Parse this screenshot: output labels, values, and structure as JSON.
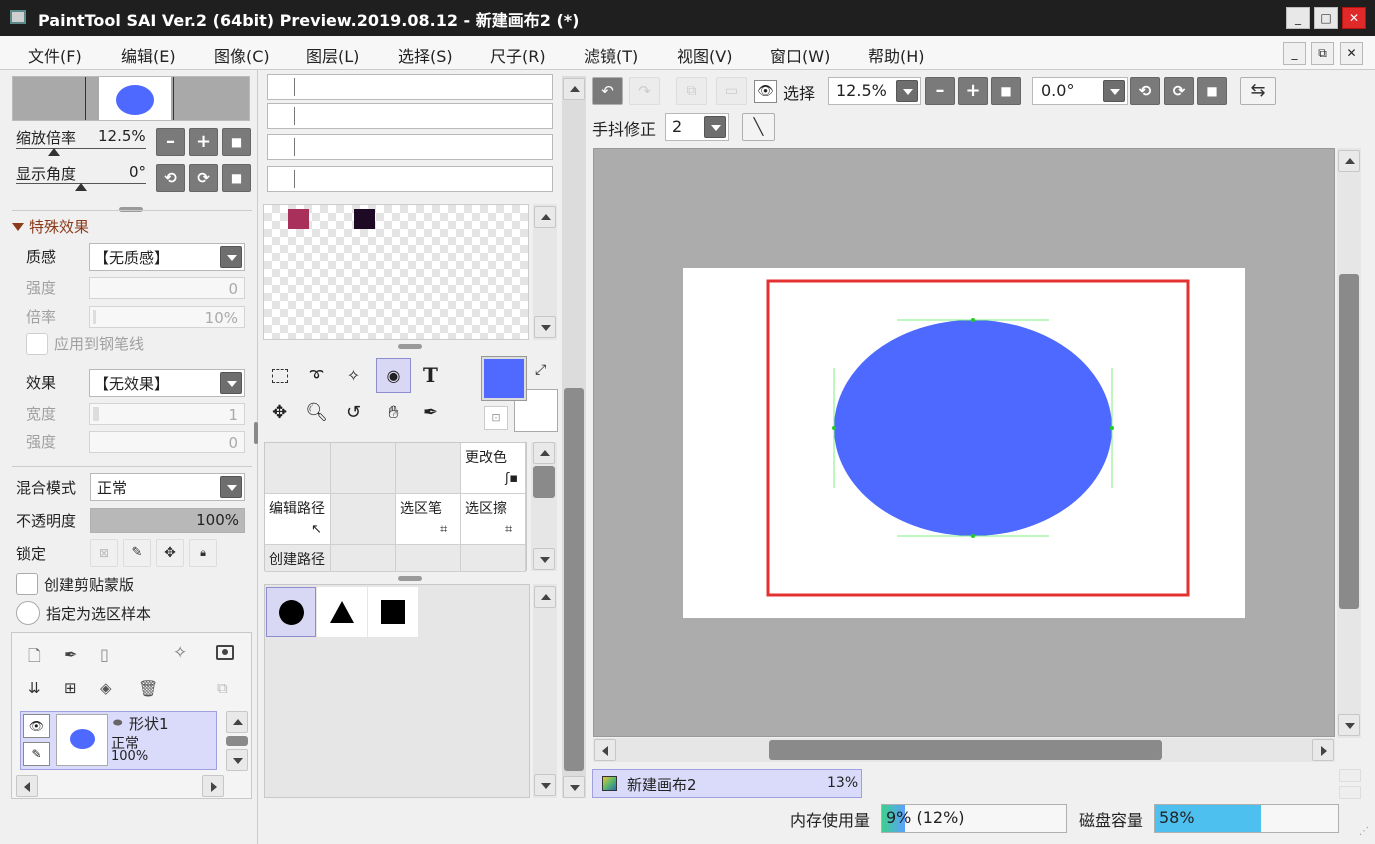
{
  "window": {
    "title": "PaintTool SAI Ver.2 (64bit) Preview.2019.08.12 - 新建画布2 (*)",
    "minimize": "_",
    "maximize": "□",
    "close": "✕"
  },
  "menu": {
    "items": [
      "文件(F)",
      "编辑(E)",
      "图像(C)",
      "图层(L)",
      "选择(S)",
      "尺子(R)",
      "滤镜(T)",
      "视图(V)",
      "窗口(W)",
      "帮助(H)"
    ],
    "mdi_minimize": "_",
    "mdi_restore": "⧉",
    "mdi_close": "✕"
  },
  "navigator": {
    "zoom_label": "缩放倍率",
    "zoom_value": "12.5%",
    "angle_label": "显示角度",
    "angle_value": "0°"
  },
  "effects": {
    "section_title": "特殊效果",
    "texture_label": "质感",
    "texture_value": "【无质感】",
    "strength_label": "强度",
    "strength_value": "0",
    "scale_label": "倍率",
    "scale_value": "10%",
    "apply_pen_label": "应用到钢笔线",
    "effect_label": "效果",
    "effect_value": "【无效果】",
    "width_label": "宽度",
    "width_value": "1",
    "strength2_label": "强度",
    "strength2_value": "0"
  },
  "layer_props": {
    "blend_label": "混合模式",
    "blend_value": "正常",
    "opacity_label": "不透明度",
    "opacity_value": "100%",
    "opacity_fraction": 1.0,
    "lock_label": "锁定",
    "clip_label": "创建剪贴蒙版",
    "sample_label": "指定为选区样本"
  },
  "layers": [
    {
      "name": "形状1",
      "mode": "正常",
      "opacity": "100%"
    }
  ],
  "palette": {
    "swatches": [
      "#a8305a",
      "#1e0a24"
    ]
  },
  "tool_grid": {
    "cells": [
      [
        "",
        "",
        "",
        "更改色"
      ],
      [
        "编辑路径",
        "",
        "选区笔",
        "选区擦"
      ],
      [
        "创建路径",
        "",
        "",
        ""
      ]
    ]
  },
  "colors": {
    "foreground": "#5069ff",
    "background": "#ffffff",
    "canvas_shape": "#4e69ff",
    "selection_border": "#e53030"
  },
  "canvas_toolbar": {
    "select_label": "选择",
    "zoom_value": "12.5%",
    "angle_value": "0.0°",
    "stabilizer_label": "手抖修正",
    "stabilizer_value": "2"
  },
  "document_tab": {
    "name": "新建画布2",
    "zoom": "13%"
  },
  "status": {
    "memory_label": "内存使用量",
    "memory_value": "9% (12%)",
    "memory_fraction": 0.09,
    "disk_label": "磁盘容量",
    "disk_value": "58%",
    "disk_fraction": 0.58
  }
}
